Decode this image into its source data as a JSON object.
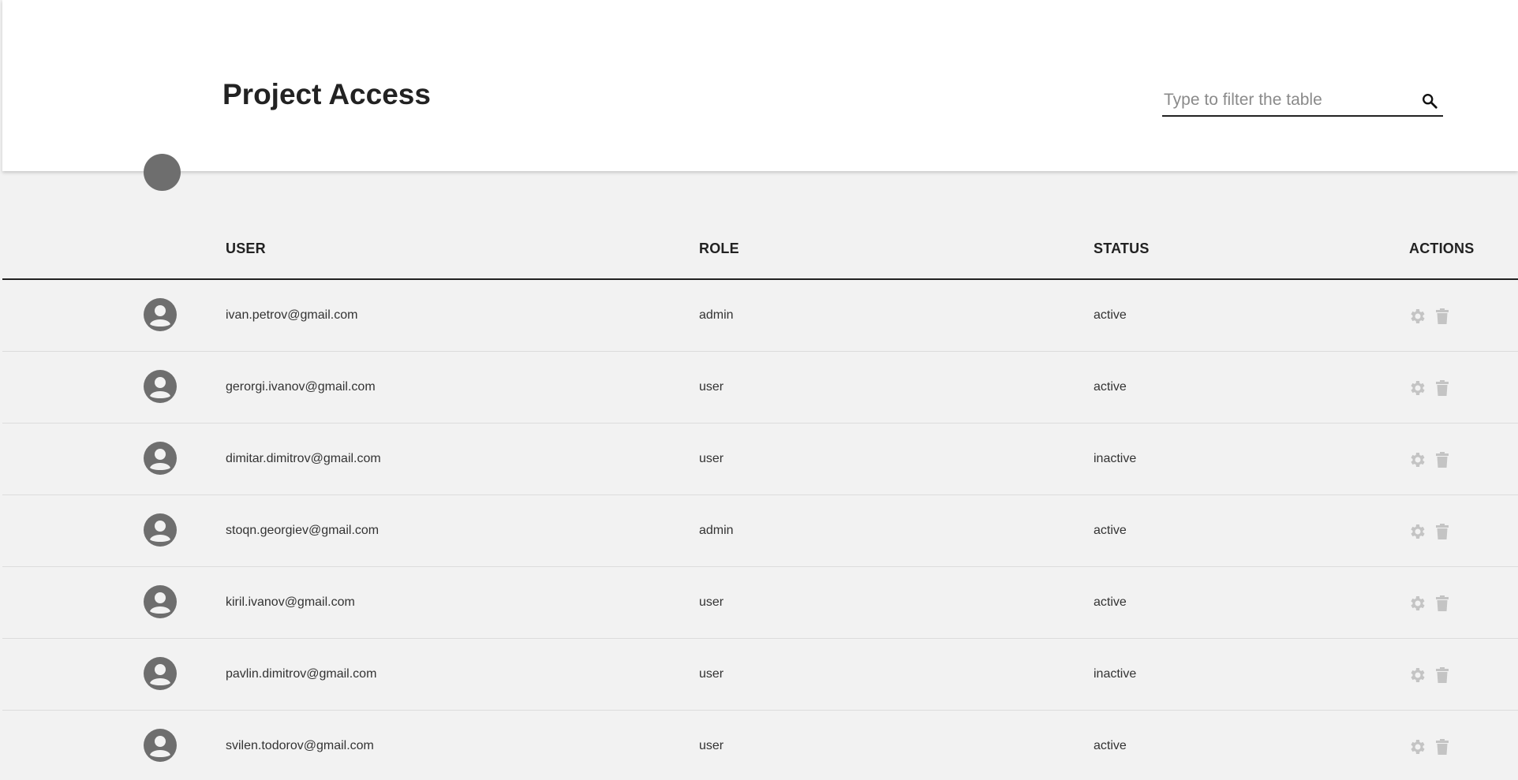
{
  "header": {
    "title": "Project Access",
    "search_placeholder": "Type to filter the table",
    "search_value": ""
  },
  "table": {
    "columns": [
      "USER",
      "ROLE",
      "STATUS",
      "ACTIONS"
    ],
    "rows": [
      {
        "user": "ivan.petrov@gmail.com",
        "role": "admin",
        "status": "active"
      },
      {
        "user": "gerorgi.ivanov@gmail.com",
        "role": "user",
        "status": "active"
      },
      {
        "user": "dimitar.dimitrov@gmail.com",
        "role": "user",
        "status": "inactive"
      },
      {
        "user": "stoqn.georgiev@gmail.com",
        "role": "admin",
        "status": "active"
      },
      {
        "user": "kiril.ivanov@gmail.com",
        "role": "user",
        "status": "active"
      },
      {
        "user": "pavlin.dimitrov@gmail.com",
        "role": "user",
        "status": "inactive"
      },
      {
        "user": "svilen.todorov@gmail.com",
        "role": "user",
        "status": "active"
      }
    ]
  },
  "icons": {
    "search": "search-icon",
    "avatar": "user-avatar-icon",
    "settings": "gear-icon",
    "delete": "trash-icon"
  },
  "colors": {
    "header_bg": "#ffffff",
    "page_bg": "#f2f2f2",
    "avatar": "#6e6e6e",
    "action_icon": "#c4c4c4",
    "text": "#222222"
  }
}
